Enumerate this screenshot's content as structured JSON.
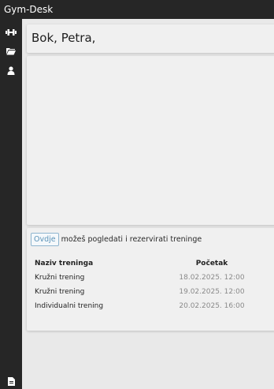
{
  "app": {
    "title": "Gym-Desk"
  },
  "sidebar": {
    "icons": [
      "dumbbell-icon",
      "folder-icon",
      "user-icon",
      "document-icon"
    ]
  },
  "greeting": "Bok, Petra,",
  "trainings": {
    "link_label": "Ovdje",
    "intro_text": "možeš pogledati i rezervirati treninge",
    "columns": [
      "Naziv treninga",
      "Početak"
    ],
    "rows": [
      {
        "name": "Kružni trening",
        "start": "18.02.2025. 12:00"
      },
      {
        "name": "Kružni trening",
        "start": "19.02.2025. 12:00"
      },
      {
        "name": "Individualni trening",
        "start": "20.02.2025. 16:00"
      }
    ]
  },
  "colors": {
    "topbar": "#262626",
    "sidebar": "#262626",
    "background": "#e9e9e9",
    "card": "#f0f0f0",
    "link": "#5c93b8"
  }
}
